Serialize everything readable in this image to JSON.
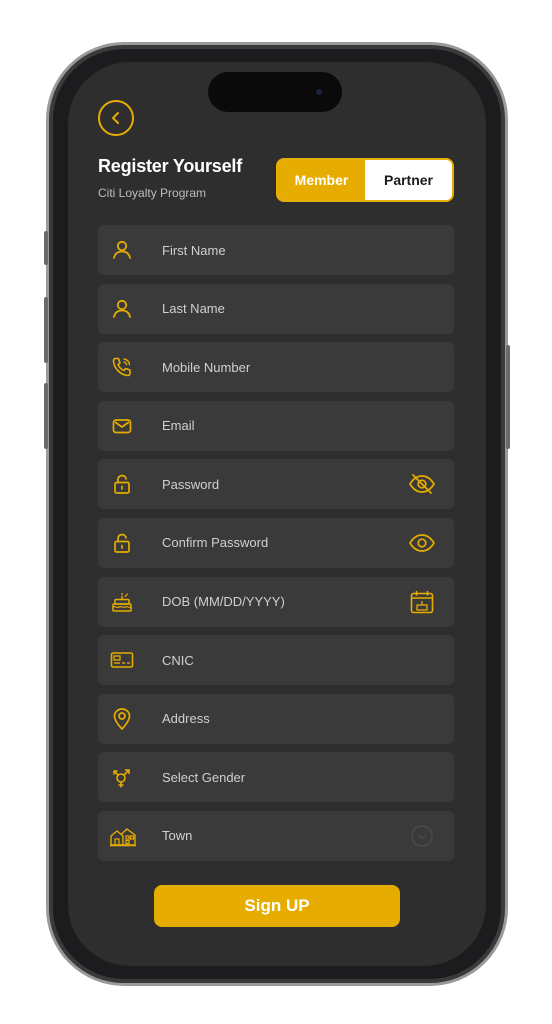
{
  "header": {
    "title": "Register Yourself",
    "subtitle": "Citi Loyalty Program"
  },
  "toggle": {
    "member_label": "Member",
    "partner_label": "Partner",
    "selected": "Member"
  },
  "fields": [
    {
      "label": "First Name",
      "icon": "user-icon"
    },
    {
      "label": "Last Name",
      "icon": "user-icon"
    },
    {
      "label": "Mobile Number",
      "icon": "phone-icon"
    },
    {
      "label": "Email",
      "icon": "mail-icon"
    },
    {
      "label": "Password",
      "icon": "lock-icon",
      "trailing_icon": "eye-off-icon"
    },
    {
      "label": "Confirm Password",
      "icon": "lock-icon",
      "trailing_icon": "eye-icon"
    },
    {
      "label": "DOB (MM/DD/YYYY)",
      "icon": "cake-icon",
      "trailing_icon": "calendar-icon"
    },
    {
      "label": "CNIC",
      "icon": "id-card-icon"
    },
    {
      "label": "Address",
      "icon": "location-pin-icon"
    },
    {
      "label": "Select Gender",
      "icon": "gender-icon"
    },
    {
      "label": "Town",
      "icon": "town-icon",
      "trailing_icon": "chevron-down-icon"
    }
  ],
  "signup": {
    "label": "Sign UP"
  },
  "colors": {
    "accent": "#e6ac00",
    "background": "#2e2e2e",
    "field": "#3a3a3a"
  }
}
